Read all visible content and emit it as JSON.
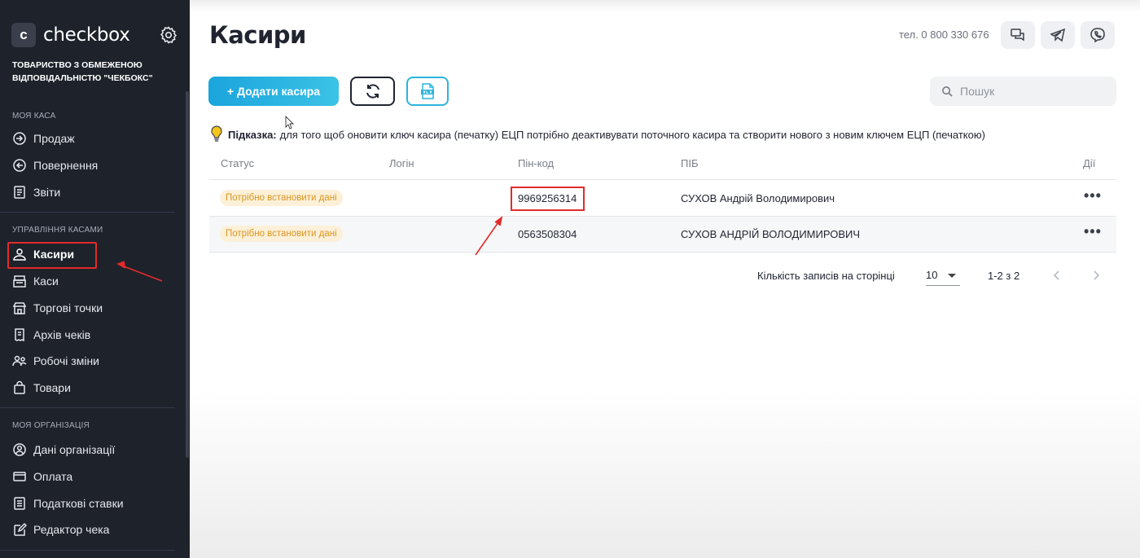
{
  "brand": {
    "logo_letter": "c",
    "name": "checkbox"
  },
  "organization": "ТОВАРИСТВО З ОБМЕЖЕНОЮ ВІДПОВІДАЛЬНІСТЮ \"ЧЕКБОКС\"",
  "sidebar": {
    "sections": [
      {
        "title": "МОЯ КАСА",
        "items": [
          {
            "label": "Продаж",
            "icon": "login-arrow-icon"
          },
          {
            "label": "Повернення",
            "icon": "return-icon"
          },
          {
            "label": "Звіти",
            "icon": "report-icon"
          }
        ]
      },
      {
        "title": "УПРАВЛІННЯ КАСАМИ",
        "items": [
          {
            "label": "Касири",
            "icon": "cashier-icon",
            "active": true
          },
          {
            "label": "Каси",
            "icon": "register-icon"
          },
          {
            "label": "Торгові точки",
            "icon": "store-icon"
          },
          {
            "label": "Архів чеків",
            "icon": "receipt-archive-icon"
          },
          {
            "label": "Робочі зміни",
            "icon": "shifts-icon"
          },
          {
            "label": "Товари",
            "icon": "bag-icon"
          }
        ]
      },
      {
        "title": "МОЯ ОРГАНІЗАЦІЯ",
        "items": [
          {
            "label": "Дані організації",
            "icon": "org-data-icon"
          },
          {
            "label": "Оплата",
            "icon": "payment-icon"
          },
          {
            "label": "Податкові ставки",
            "icon": "tax-icon"
          },
          {
            "label": "Редактор чека",
            "icon": "edit-icon"
          }
        ]
      }
    ]
  },
  "header": {
    "title": "Касири",
    "phone": "тел. 0 800 330 676",
    "icons": [
      "chat-icon",
      "telegram-icon",
      "viber-icon"
    ]
  },
  "toolbar": {
    "add_label": "+ Додати касира",
    "refresh_icon": "refresh-icon",
    "export_icon": "xlsx-icon",
    "search_placeholder": "Пошук"
  },
  "hint": {
    "label": "Підказка:",
    "text": "для того щоб оновити ключ касира (печатку) ЕЦП потрібно деактивувати поточного касира та створити нового з новим ключем ЕЦП (печаткою)"
  },
  "table": {
    "columns": [
      "Статус",
      "Логін",
      "Пін-код",
      "ПІБ",
      "Дії"
    ],
    "rows": [
      {
        "status": "Потрібно встановити дані",
        "login": "",
        "pin": "9969256314",
        "name": "СУХОВ Андрій Володимирович",
        "actions": "•••"
      },
      {
        "status": "Потрібно встановити дані",
        "login": "",
        "pin": "0563508304",
        "name": "СУХОВ АНДРІЙ ВОЛОДИМИРОВИЧ",
        "actions": "•••"
      }
    ]
  },
  "pagination": {
    "per_page_label": "Кількість записів на сторінці",
    "per_page_value": "10",
    "range": "1-2 з 2"
  },
  "colors": {
    "sidebar_bg": "#1e222b",
    "accent": "#1aa5dc",
    "badge_bg": "#fdf0d8",
    "badge_text": "#d99620",
    "annotation_red": "#e32a2a"
  }
}
